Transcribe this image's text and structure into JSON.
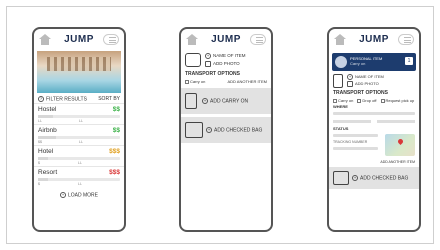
{
  "phone1": {
    "logo": "JUMP",
    "filter_label": "FILTER RESULTS",
    "sort_label": "SORT BY",
    "items": [
      {
        "name": "Hostel",
        "price": "$$",
        "color": "#3db24a",
        "mini_left": "LL",
        "mini_mid": "LL"
      },
      {
        "name": "Airbnb",
        "price": "$$",
        "color": "#3db24a",
        "mini_left": "$$",
        "mini_mid": "LL"
      },
      {
        "name": "Hotel",
        "price": "$$$",
        "color": "#e0a020",
        "mini_left": "$",
        "mini_mid": "LL"
      },
      {
        "name": "Resort",
        "price": "$$$",
        "color": "#d93838",
        "mini_left": "$",
        "mini_mid": "LL"
      }
    ],
    "load_more": "LOAD MORE"
  },
  "phone2": {
    "logo": "JUMP",
    "name_of_item": "NAME OF ITEM",
    "add_photo": "ADD PHOTO",
    "transport_options": "TRANSPORT OPTIONS",
    "carry_on_check": "Carry on",
    "add_another_item": "ADD ANOTHER ITEM",
    "add_carry_on": "ADD CARRY ON",
    "add_checked_bag": "ADD CHECKED BAG"
  },
  "phone3": {
    "logo": "JUMP",
    "card_title": "PERSONAL ITEM",
    "card_sub": "Carry on",
    "card_badge": "1",
    "name_of_item": "NAME OF ITEM",
    "add_photo": "ADD PHOTO",
    "transport_options": "TRANSPORT OPTIONS",
    "opt1": "Carry on",
    "opt2": "Drop off",
    "opt3": "Request pick up",
    "where": "WHERE",
    "status": "STATUS",
    "tracking": "TRACKING NUMBER",
    "add_another_item": "ADD ANOTHER ITEM",
    "add_checked_bag": "ADD CHECKED BAG"
  }
}
